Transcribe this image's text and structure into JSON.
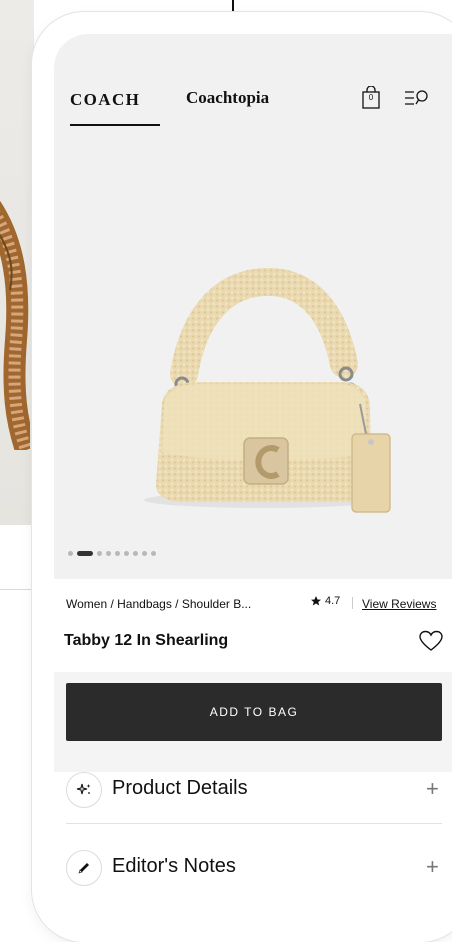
{
  "header": {
    "brand_logo": "COACH",
    "brand_alt": "Coachtopia",
    "bag_count": "0"
  },
  "product": {
    "breadcrumb": "Women / Handbags / Shoulder B...",
    "rating": "4.7",
    "view_reviews": "View Reviews",
    "title": "Tabby 12 In Shearling",
    "carousel": {
      "total": 9,
      "active": 1
    }
  },
  "actions": {
    "add_to_bag": "ADD TO BAG"
  },
  "accordion": {
    "product_details": "Product Details",
    "editors_notes": "Editor's Notes"
  },
  "colors": {
    "hero_bg": "#f1f1f1",
    "button_bg": "#2b2b2b",
    "shearling": "#ead9b0"
  }
}
